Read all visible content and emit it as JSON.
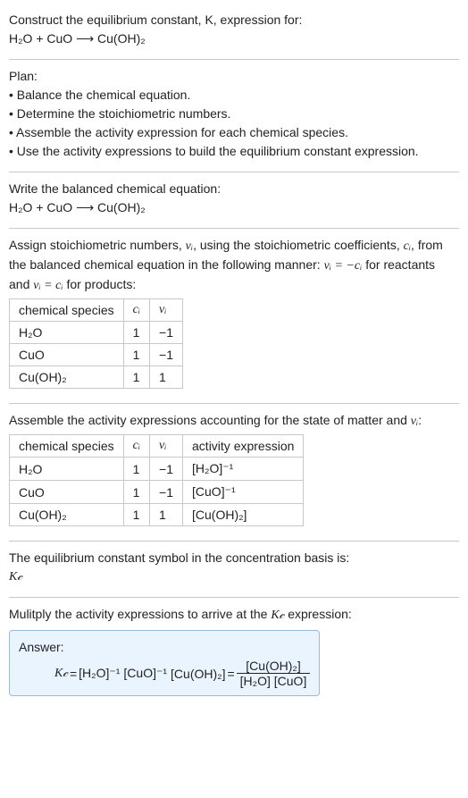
{
  "s1": {
    "l1": "Construct the equilibrium constant, K, expression for:",
    "l2": "H₂O + CuO ⟶ Cu(OH)₂"
  },
  "s2": {
    "h": "Plan:",
    "b1": "• Balance the chemical equation.",
    "b2": "• Determine the stoichiometric numbers.",
    "b3": "• Assemble the activity expression for each chemical species.",
    "b4": "• Use the activity expressions to build the equilibrium constant expression."
  },
  "s3": {
    "l1": "Write the balanced chemical equation:",
    "l2": "H₂O + CuO ⟶ Cu(OH)₂"
  },
  "s4": {
    "p1a": "Assign stoichiometric numbers, ",
    "p1b": "νᵢ",
    "p1c": ", using the stoichiometric coefficients, ",
    "p1d": "cᵢ",
    "p1e": ", from the balanced chemical equation in the following manner: ",
    "p1f": "νᵢ = −cᵢ",
    "p1g": " for reactants and ",
    "p1h": "νᵢ = cᵢ",
    "p1i": " for products:",
    "th1": "chemical species",
    "th2": "cᵢ",
    "th3": "νᵢ",
    "r1c1": "H₂O",
    "r1c2": "1",
    "r1c3": "−1",
    "r2c1": "CuO",
    "r2c2": "1",
    "r2c3": "−1",
    "r3c1": "Cu(OH)₂",
    "r3c2": "1",
    "r3c3": "1",
    "chart_data": {
      "type": "table",
      "columns": [
        "chemical species",
        "cᵢ",
        "νᵢ"
      ],
      "rows": [
        [
          "H₂O",
          1,
          -1
        ],
        [
          "CuO",
          1,
          -1
        ],
        [
          "Cu(OH)₂",
          1,
          1
        ]
      ]
    }
  },
  "s5": {
    "p1a": "Assemble the activity expressions accounting for the state of matter and ",
    "p1b": "νᵢ",
    "p1c": ":",
    "th1": "chemical species",
    "th2": "cᵢ",
    "th3": "νᵢ",
    "th4": "activity expression",
    "r1c1": "H₂O",
    "r1c2": "1",
    "r1c3": "−1",
    "r1c4": "[H₂O]⁻¹",
    "r2c1": "CuO",
    "r2c2": "1",
    "r2c3": "−1",
    "r2c4": "[CuO]⁻¹",
    "r3c1": "Cu(OH)₂",
    "r3c2": "1",
    "r3c3": "1",
    "r3c4": "[Cu(OH)₂]",
    "chart_data": {
      "type": "table",
      "columns": [
        "chemical species",
        "cᵢ",
        "νᵢ",
        "activity expression"
      ],
      "rows": [
        [
          "H₂O",
          1,
          -1,
          "[H₂O]⁻¹"
        ],
        [
          "CuO",
          1,
          -1,
          "[CuO]⁻¹"
        ],
        [
          "Cu(OH)₂",
          1,
          1,
          "[Cu(OH)₂]"
        ]
      ]
    }
  },
  "s6": {
    "l1": "The equilibrium constant symbol in the concentration basis is:",
    "l2": "K𝒸"
  },
  "s7": {
    "l1a": "Mulitply the activity expressions to arrive at the ",
    "l1b": "K𝒸",
    "l1c": " expression:",
    "ans_label": "Answer:",
    "Kc": "K𝒸",
    "eq": " = ",
    "t1": "[H₂O]⁻¹",
    "sp": " ",
    "t2": "[CuO]⁻¹",
    "t3": "[Cu(OH)₂]",
    "eq2": " = ",
    "num": "[Cu(OH)₂]",
    "den": "[H₂O] [CuO]"
  }
}
